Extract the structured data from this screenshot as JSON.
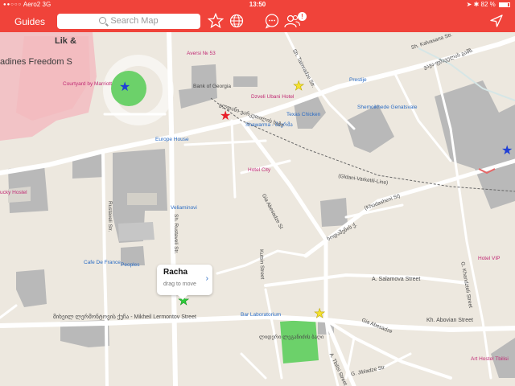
{
  "status": {
    "carrier": "Aero2",
    "network": "3G",
    "time": "13:50",
    "battery": "82 %"
  },
  "nav": {
    "guides_label": "Guides",
    "search_placeholder": "Search Map",
    "badge": "!",
    "accent": "#f0433a"
  },
  "map": {
    "streets": [
      {
        "name": "Gldani-Varketili-Line",
        "text": "(Gldani-Varketili-Line)"
      },
      {
        "name": "Gia-Abesadze",
        "text": "Gia Abesadze St"
      },
      {
        "name": "Khodasheni",
        "text": "(Khodasheni St)"
      },
      {
        "name": "Ketevan",
        "text": "Sh. Kalvasana Str."
      },
      {
        "name": "Tabidze",
        "text": "Sh. Taimradze Str."
      },
      {
        "name": "Rustaveli",
        "text": "Sh. Rustaveli Str."
      },
      {
        "name": "Rustaveli2",
        "text": "Rustaveli Str."
      },
      {
        "name": "Lermontov",
        "text": "მიხეილ ლერმონტოვის ქუჩა - Mikheil Lermontov Street"
      },
      {
        "name": "Salamova",
        "text": "A. Salamova Street"
      },
      {
        "name": "Khanda",
        "text": "G. Khandzteli Street"
      },
      {
        "name": "Abovian",
        "text": "Kh. Abovian Street"
      },
      {
        "name": "Gia2",
        "text": "Gia Abesadze"
      },
      {
        "name": "Tbilisi",
        "text": "A. Tbilisi Street"
      },
      {
        "name": "Jibladze",
        "text": "G. Jibladze Str"
      },
      {
        "name": "Kutsin",
        "text": "Kutsin Street"
      },
      {
        "name": "Kodasheni2",
        "text": "ხოდაშენის ქ."
      },
      {
        "name": "Geo",
        "text": "ვაჟა-ფშაველას გამზ."
      },
      {
        "name": "Gldani",
        "text": "გლდანი-ვარკეთილის ხაზი"
      }
    ],
    "pois": [
      {
        "name": "freedom",
        "text": "adines Freedom S"
      },
      {
        "name": "lik",
        "text": "Lik &"
      },
      {
        "name": "courtyard",
        "text": "Courtyard by Marriott"
      },
      {
        "name": "avers",
        "text": "Aversi № 53"
      },
      {
        "name": "bank",
        "text": "Bank of Georgia"
      },
      {
        "name": "dzveli",
        "text": "Dzveli Ubani Hotel"
      },
      {
        "name": "prestije",
        "text": "Prestije"
      },
      {
        "name": "shemoik",
        "text": "Shemoikhede Genatsvale"
      },
      {
        "name": "shawarma",
        "text": "Shawarma - შაურმა"
      },
      {
        "name": "texas",
        "text": "Texas Chicken"
      },
      {
        "name": "europe",
        "text": "Europe House"
      },
      {
        "name": "hotelcity",
        "text": "Hotel City"
      },
      {
        "name": "lucky",
        "text": "ucky Hostel"
      },
      {
        "name": "velia",
        "text": "Veliaminovi"
      },
      {
        "name": "cafe",
        "text": "Cafe De France"
      },
      {
        "name": "peoples",
        "text": "Peoples"
      },
      {
        "name": "hotelvip",
        "text": "Hotel VIP"
      },
      {
        "name": "bar",
        "text": "Bar Laboratorium"
      },
      {
        "name": "park",
        "text": "ლიდერი ლეგანიძის ბაღი"
      },
      {
        "name": "art",
        "text": "Art Hostel Tbilisi"
      }
    ]
  },
  "callout": {
    "title": "Racha",
    "subtitle": "drag to move",
    "chevron": "›"
  },
  "colors": {
    "star_blue": "#1f3fd6",
    "star_red": "#e8202a",
    "star_yellow": "#f5e12e",
    "star_green": "#2ecc3a",
    "park_green": "#6cd16a"
  }
}
